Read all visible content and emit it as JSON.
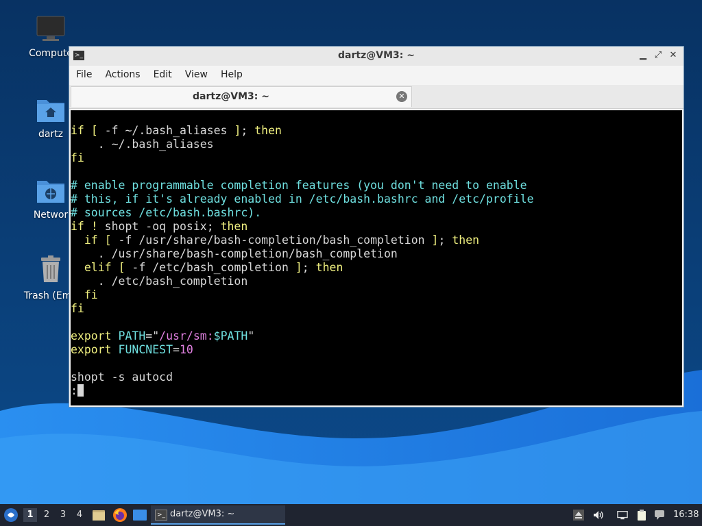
{
  "desktop": {
    "icons": [
      {
        "label": "Compute"
      },
      {
        "label": "dartz"
      },
      {
        "label": "Networ"
      },
      {
        "label": "Trash (Emp"
      }
    ]
  },
  "window": {
    "title": "dartz@VM3: ~",
    "menu": [
      "File",
      "Actions",
      "Edit",
      "View",
      "Help"
    ],
    "tab_label": "dartz@VM3: ~"
  },
  "terminal_lines": [
    "if [ -f ~/.bash_aliases ]; then",
    "    . ~/.bash_aliases",
    "fi",
    "",
    "# enable programmable completion features (you don't need to enable",
    "# this, if it's already enabled in /etc/bash.bashrc and /etc/profile",
    "# sources /etc/bash.bashrc).",
    "if ! shopt -oq posix; then",
    "  if [ -f /usr/share/bash-completion/bash_completion ]; then",
    "    . /usr/share/bash-completion/bash_completion",
    "  elif [ -f /etc/bash_completion ]; then",
    "    . /etc/bash_completion",
    "  fi",
    "fi",
    "",
    "export PATH=\"/usr/sm:$PATH\"",
    "export FUNCNEST=10",
    "",
    "shopt -s autocd",
    ":"
  ],
  "taskbar": {
    "workspaces": [
      "1",
      "2",
      "3",
      "4"
    ],
    "active_task": "dartz@VM3: ~",
    "clock": "16:38"
  },
  "colors": {
    "keyword": "#f0f080",
    "comment": "#6fe0e0",
    "string": "#e080e0",
    "accent": "#5aa0e6"
  }
}
